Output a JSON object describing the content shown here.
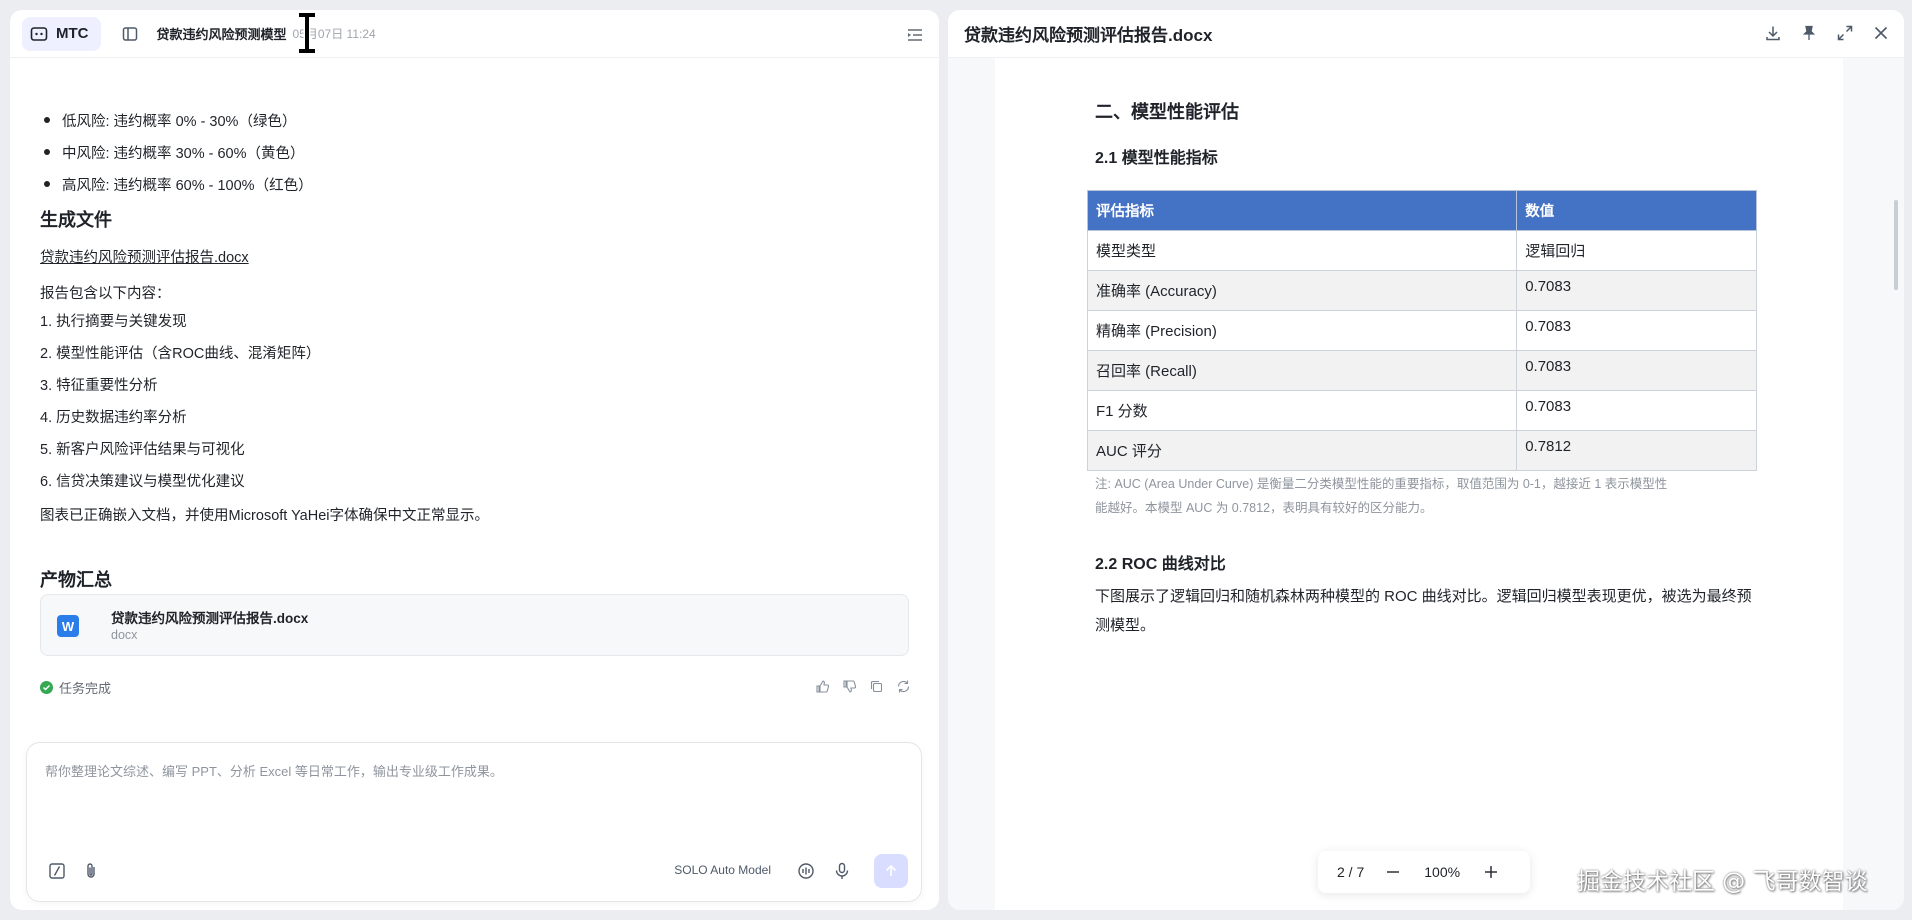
{
  "left": {
    "header": {
      "agent_label": "MTC",
      "doc_title": "贷款违约风险预测模型",
      "timestamp": "05月07日 11:24"
    },
    "risk_levels": [
      "低风险: 违约概率 0% - 30%（绿色）",
      "中风险: 违约概率 30% - 60%（黄色）",
      "高风险: 违约概率 60% - 100%（红色）"
    ],
    "generated_section_title": "生成文件",
    "file_link": "贷款违约风险预测评估报告.docx",
    "contents_intro": "报告包含以下内容：",
    "contents": [
      "1. 执行摘要与关键发现",
      "2. 模型性能评估（含ROC曲线、混淆矩阵）",
      "3. 特征重要性分析",
      "4. 历史数据违约率分析",
      "5. 新客户风险评估结果与可视化",
      "6. 信贷决策建议与模型优化建议"
    ],
    "embed_note": "图表已正确嵌入文档，并使用Microsoft YaHei字体确保中文正常显示。",
    "artifacts_title": "产物汇总",
    "artifact": {
      "icon_letter": "W",
      "name": "贷款违约风险预测评估报告.docx",
      "type": "docx"
    },
    "status": "任务完成",
    "composer": {
      "placeholder": "帮你整理论文综述、编写 PPT、分析 Excel 等日常工作，输出专业级工作成果。",
      "model": "SOLO Auto Model"
    }
  },
  "right": {
    "title": "贷款违约风险预测评估报告.docx",
    "doc": {
      "h1": "二、模型性能评估",
      "h2_metrics": "2.1 模型性能指标",
      "table_headers": [
        "评估指标",
        "数值"
      ],
      "table_rows": [
        [
          "模型类型",
          "逻辑回归"
        ],
        [
          "准确率 (Accuracy)",
          "0.7083"
        ],
        [
          "精确率 (Precision)",
          "0.7083"
        ],
        [
          "召回率 (Recall)",
          "0.7083"
        ],
        [
          "F1 分数",
          "0.7083"
        ],
        [
          "AUC 评分",
          "0.7812"
        ]
      ],
      "note_line1": "注: AUC (Area Under Curve) 是衡量二分类模型性能的重要指标，取值范围为  0-1，越接近  1 表示模型性",
      "note_line2": "能越好。本模型  AUC 为  0.7812，表明具有较好的区分能力。",
      "h2_roc": "2.2 ROC 曲线对比",
      "para": "下图展示了逻辑回归和随机森林两种模型的  ROC 曲线对比。逻辑回归模型表现更优，被选为最终预测模型。"
    },
    "pager": {
      "page": "2 / 7",
      "zoom": "100%"
    }
  },
  "watermark": "掘金技术社区 @ 飞哥数智谈",
  "colors": {
    "accent": "#4472c4",
    "success": "#34a853",
    "send_bg": "#d9ddff"
  }
}
